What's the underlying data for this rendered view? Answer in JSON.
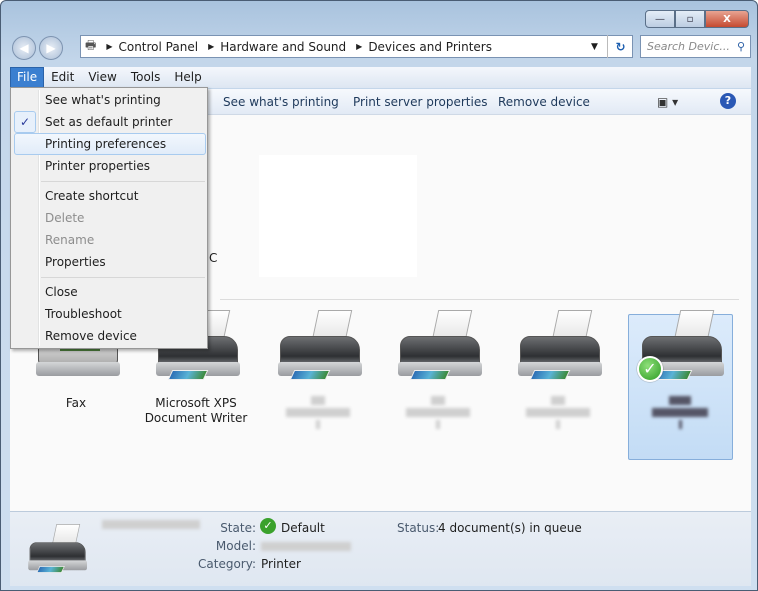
{
  "window": {
    "controls": {
      "minimize": "—",
      "maximize": "▫",
      "close": "X"
    }
  },
  "nav": {
    "back_icon": "◀",
    "forward_icon": "▶",
    "breadcrumb": [
      "Control Panel",
      "Hardware and Sound",
      "Devices and Printers"
    ],
    "refresh_icon": "↻",
    "search_placeholder": "Search Devic...",
    "search_icon": "⚲"
  },
  "menubar": [
    "File",
    "Edit",
    "View",
    "Tools",
    "Help"
  ],
  "toolbar": {
    "items": [
      "See what's printing",
      "Print server properties",
      "Remove device"
    ],
    "view_icon": "▣ ▾",
    "help_icon": "?"
  },
  "file_menu": {
    "items": [
      {
        "label": "See what's printing",
        "enabled": true
      },
      {
        "label": "Set as default printer",
        "enabled": true,
        "checked": true
      },
      {
        "label": "Printing preferences",
        "enabled": true,
        "highlighted": true
      },
      {
        "label": "Printer properties",
        "enabled": true
      },
      {
        "label": "Create shortcut",
        "enabled": true
      },
      {
        "label": "Delete",
        "enabled": false
      },
      {
        "label": "Rename",
        "enabled": false
      },
      {
        "label": "Properties",
        "enabled": true
      },
      {
        "label": "Close",
        "enabled": true
      },
      {
        "label": "Troubleshoot",
        "enabled": true
      },
      {
        "label": "Remove device",
        "enabled": true
      }
    ],
    "check_icon": "✓"
  },
  "devices": {
    "partial_label": "C",
    "printers": [
      {
        "name": "Fax"
      },
      {
        "name": "Microsoft XPS Document Writer"
      },
      {
        "name": ""
      },
      {
        "name": ""
      },
      {
        "name": ""
      },
      {
        "name": "",
        "default": true,
        "selected": true
      }
    ]
  },
  "details": {
    "state_label": "State:",
    "state_value": "Default",
    "model_label": "Model:",
    "category_label": "Category:",
    "category_value": "Printer",
    "status_label": "Status:",
    "status_value": "4 document(s) in queue"
  }
}
